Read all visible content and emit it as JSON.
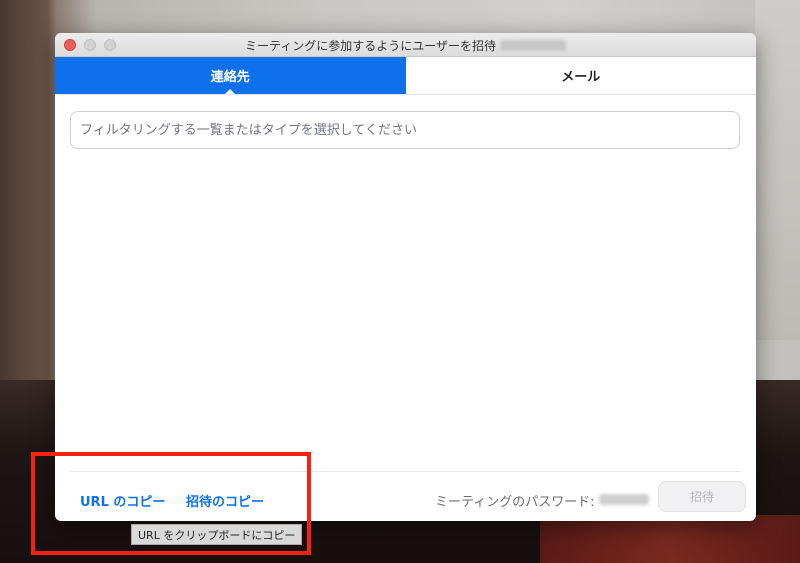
{
  "window": {
    "title": "ミーティングに参加するようにユーザーを招待"
  },
  "tabs": [
    {
      "label": "連絡先",
      "active": true
    },
    {
      "label": "メール",
      "active": false
    }
  ],
  "search": {
    "placeholder": "フィルタリングする一覧またはタイプを選択してください",
    "value": ""
  },
  "footer": {
    "copy_url_label": "URL のコピー",
    "copy_invite_label": "招待のコピー",
    "password_label": "ミーティングのパスワード:",
    "invite_button_label": "招待"
  },
  "tooltip": {
    "text": "URL をクリップボードにコピー"
  },
  "colors": {
    "accent": "#0e71eb",
    "highlight": "#f5220f"
  }
}
